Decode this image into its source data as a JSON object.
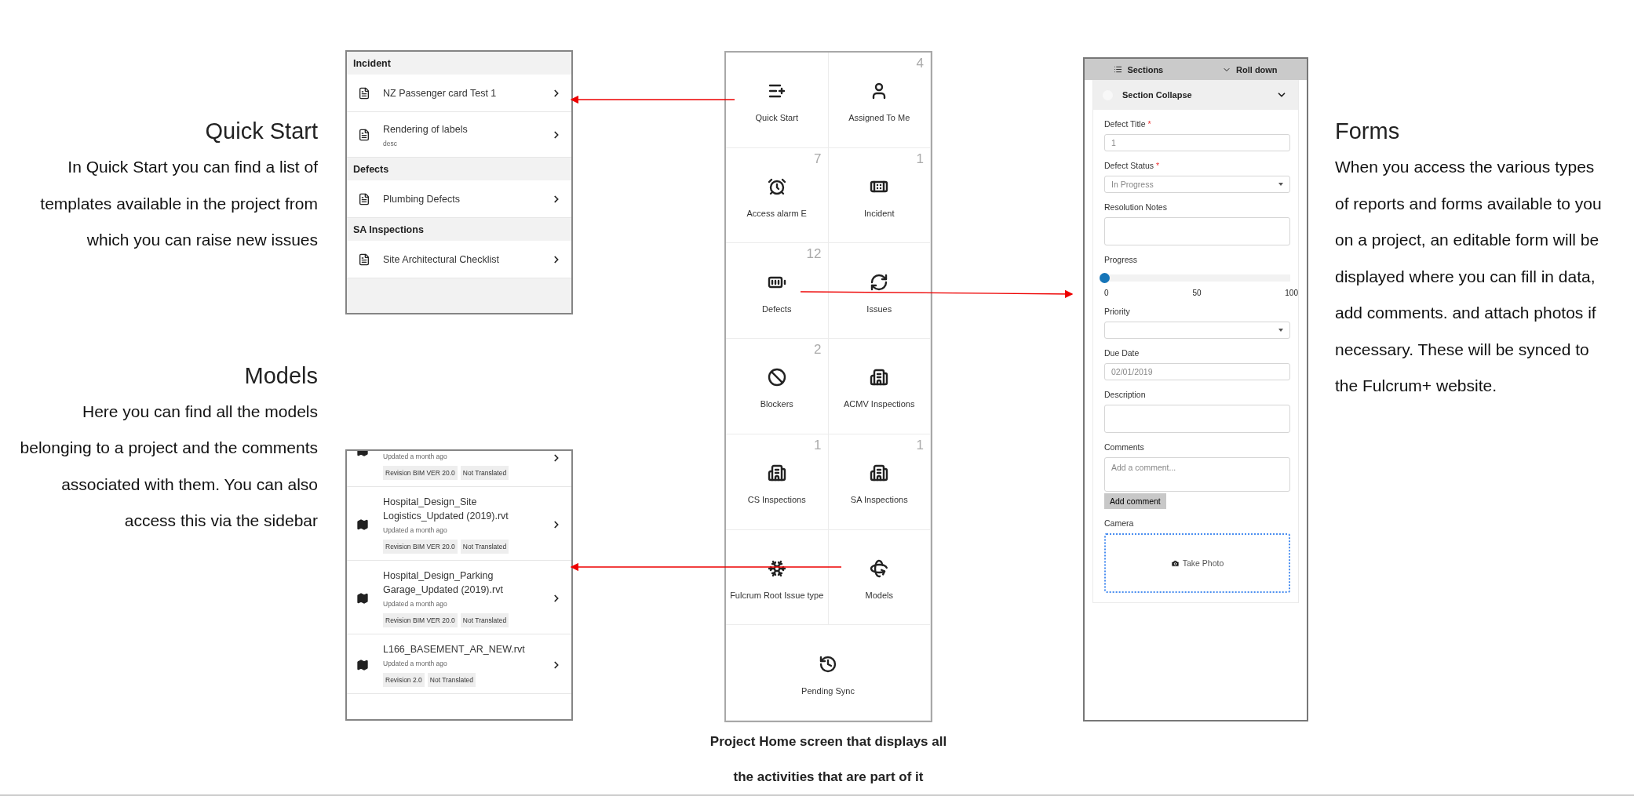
{
  "notes": [
    {
      "title": "Quick Start",
      "body": "In Quick Start you can find a list of templates available in the project from which you can raise new issues"
    },
    {
      "title": "Models",
      "body": "Here you can find all the models belonging to a project and the comments associated with them. You can also access this via the sidebar"
    },
    {
      "title": "Forms",
      "body": "When you access the various types of reports and forms available to you on a project, an editable form will be displayed where you can fill in data, add comments. and attach photos if necessary. These will be synced to the Fulcrum+ website."
    }
  ],
  "quick_start_panel": {
    "sections": [
      {
        "header": "Incident",
        "items": [
          {
            "title": "NZ Passenger card Test 1"
          },
          {
            "title": "Rendering of labels",
            "subtitle": "desc"
          }
        ]
      },
      {
        "header": "Defects",
        "items": [
          {
            "title": "Plumbing Defects"
          }
        ]
      },
      {
        "header": "SA Inspections",
        "items": [
          {
            "title": "Site Architectural Checklist"
          }
        ]
      }
    ]
  },
  "models_panel": {
    "items": [
      {
        "updated": "Updated a month ago",
        "tags": [
          "Revision BIM VER 20.0",
          "Not Translated"
        ]
      },
      {
        "title": "Hospital_Design_Site Logistics_Updated (2019).rvt",
        "updated": "Updated a month ago",
        "tags": [
          "Revision BIM VER 20.0",
          "Not Translated"
        ]
      },
      {
        "title": "Hospital_Design_Parking Garage_Updated (2019).rvt",
        "updated": "Updated a month ago",
        "tags": [
          "Revision BIM VER 20.0",
          "Not Translated"
        ]
      },
      {
        "title": "L166_BASEMENT_AR_NEW.rvt",
        "updated": "Updated a month ago",
        "tags": [
          "Revision 2.0",
          "Not Translated"
        ]
      }
    ]
  },
  "home_tiles": [
    {
      "label": "Quick Start"
    },
    {
      "label": "Assigned To Me",
      "count": "4"
    },
    {
      "label": "Access alarm E",
      "count": "7"
    },
    {
      "label": "Incident",
      "count": "1"
    },
    {
      "label": "Defects",
      "count": "12"
    },
    {
      "label": "Issues"
    },
    {
      "label": "Blockers",
      "count": "2"
    },
    {
      "label": "ACMV Inspections"
    },
    {
      "label": "CS Inspections",
      "count": "1"
    },
    {
      "label": "SA Inspections",
      "count": "1"
    },
    {
      "label": "Fulcrum Root Issue type"
    },
    {
      "label": "Models"
    },
    {
      "label": "Pending Sync"
    }
  ],
  "caption": "Project Home screen that displays all the activities that are part of it",
  "form": {
    "toolbar": [
      "Sections",
      "Roll down"
    ],
    "section": {
      "title": "Section Collapse",
      "expanded": true
    },
    "fields": [
      {
        "kind": "text",
        "label": "Defect Title",
        "required_mark": "*",
        "value": "1"
      },
      {
        "kind": "select",
        "label": "Defect Status",
        "required_mark": "*",
        "value": "In Progress"
      },
      {
        "kind": "textarea",
        "label": "Resolution Notes"
      },
      {
        "kind": "slider",
        "label": "Progress",
        "level": 0,
        "ticks": [
          "0",
          "50",
          "100"
        ]
      },
      {
        "kind": "select",
        "label": "Priority"
      },
      {
        "kind": "text",
        "label": "Due Date",
        "value": "02/01/2019"
      },
      {
        "kind": "textarea",
        "label": "Description"
      },
      {
        "kind": "comment",
        "label": "Comments",
        "placeholder": "Add a comment...",
        "button": "Add comment"
      },
      {
        "kind": "camera",
        "label": "Camera",
        "button": "Take Photo"
      }
    ]
  }
}
